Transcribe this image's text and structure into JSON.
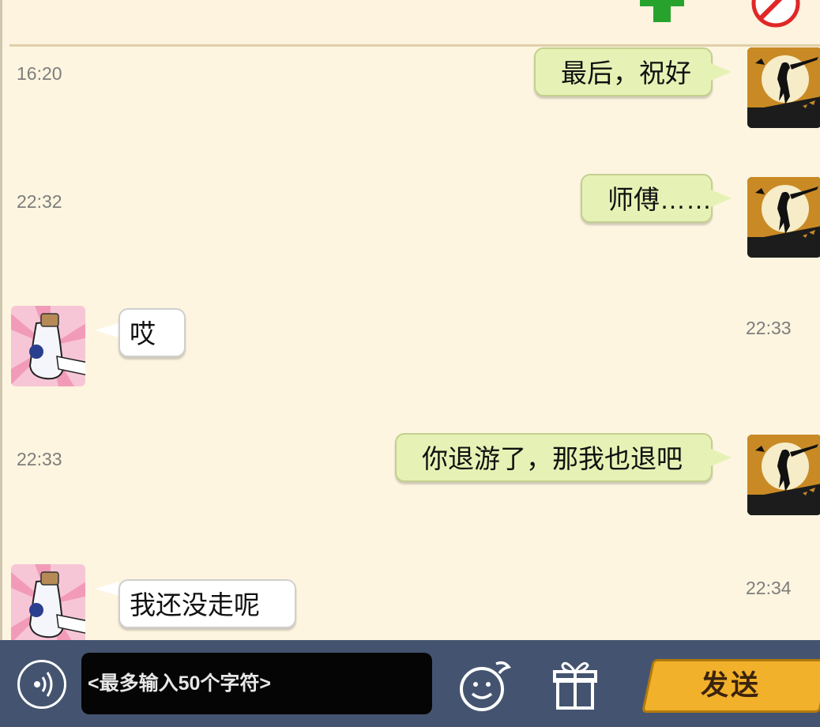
{
  "header": {
    "add_icon": "plus-icon",
    "block_icon": "ban-icon",
    "accent_green": "#27a32d",
    "accent_red": "#e02727"
  },
  "messages": [
    {
      "sender": "me",
      "time": "16:20",
      "text": "最后，祝好",
      "avatar": "moon-silhouette-avatar"
    },
    {
      "sender": "me",
      "time": "22:32",
      "text": "师傅……",
      "avatar": "moon-silhouette-avatar"
    },
    {
      "sender": "them",
      "time": "22:33",
      "text": "哎",
      "avatar": "bottle-avatar"
    },
    {
      "sender": "me",
      "time": "22:33",
      "text": "你退游了，那我也退吧",
      "avatar": "moon-silhouette-avatar"
    },
    {
      "sender": "them",
      "time": "22:34",
      "text": "我还没走呢",
      "avatar": "bottle-avatar"
    }
  ],
  "composer": {
    "placeholder": "<最多输入50个字符>",
    "send_label": "发送",
    "voice_icon": "voice-icon",
    "emoji_icon": "emoji-icon",
    "gift_icon": "gift-icon"
  },
  "colors": {
    "chat_background": "#fdf5e0",
    "my_bubble": "#e6f2b5",
    "their_bubble": "#ffffff",
    "bottom_bar": "#445470",
    "send_button": "#f2b12a"
  }
}
